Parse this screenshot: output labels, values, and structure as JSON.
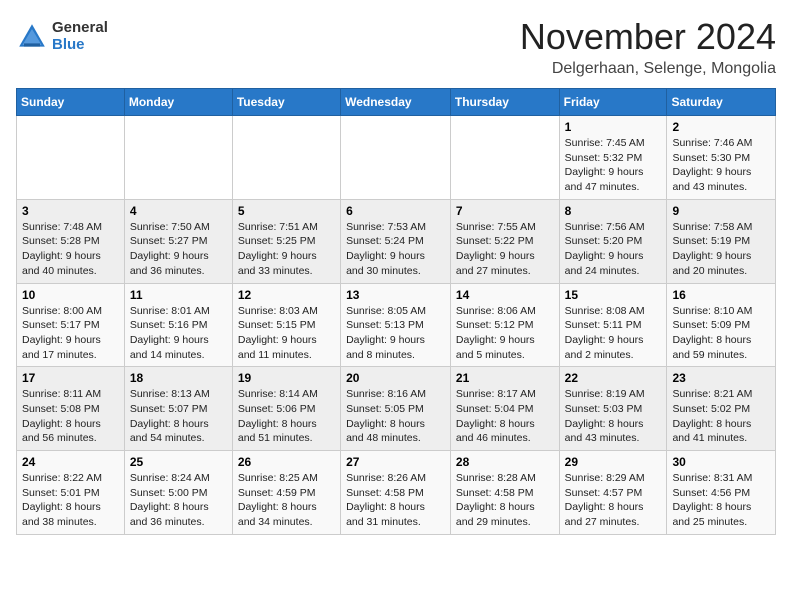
{
  "logo": {
    "general": "General",
    "blue": "Blue"
  },
  "header": {
    "month": "November 2024",
    "location": "Delgerhaan, Selenge, Mongolia"
  },
  "weekdays": [
    "Sunday",
    "Monday",
    "Tuesday",
    "Wednesday",
    "Thursday",
    "Friday",
    "Saturday"
  ],
  "weeks": [
    [
      {
        "day": "",
        "info": ""
      },
      {
        "day": "",
        "info": ""
      },
      {
        "day": "",
        "info": ""
      },
      {
        "day": "",
        "info": ""
      },
      {
        "day": "",
        "info": ""
      },
      {
        "day": "1",
        "info": "Sunrise: 7:45 AM\nSunset: 5:32 PM\nDaylight: 9 hours and 47 minutes."
      },
      {
        "day": "2",
        "info": "Sunrise: 7:46 AM\nSunset: 5:30 PM\nDaylight: 9 hours and 43 minutes."
      }
    ],
    [
      {
        "day": "3",
        "info": "Sunrise: 7:48 AM\nSunset: 5:28 PM\nDaylight: 9 hours and 40 minutes."
      },
      {
        "day": "4",
        "info": "Sunrise: 7:50 AM\nSunset: 5:27 PM\nDaylight: 9 hours and 36 minutes."
      },
      {
        "day": "5",
        "info": "Sunrise: 7:51 AM\nSunset: 5:25 PM\nDaylight: 9 hours and 33 minutes."
      },
      {
        "day": "6",
        "info": "Sunrise: 7:53 AM\nSunset: 5:24 PM\nDaylight: 9 hours and 30 minutes."
      },
      {
        "day": "7",
        "info": "Sunrise: 7:55 AM\nSunset: 5:22 PM\nDaylight: 9 hours and 27 minutes."
      },
      {
        "day": "8",
        "info": "Sunrise: 7:56 AM\nSunset: 5:20 PM\nDaylight: 9 hours and 24 minutes."
      },
      {
        "day": "9",
        "info": "Sunrise: 7:58 AM\nSunset: 5:19 PM\nDaylight: 9 hours and 20 minutes."
      }
    ],
    [
      {
        "day": "10",
        "info": "Sunrise: 8:00 AM\nSunset: 5:17 PM\nDaylight: 9 hours and 17 minutes."
      },
      {
        "day": "11",
        "info": "Sunrise: 8:01 AM\nSunset: 5:16 PM\nDaylight: 9 hours and 14 minutes."
      },
      {
        "day": "12",
        "info": "Sunrise: 8:03 AM\nSunset: 5:15 PM\nDaylight: 9 hours and 11 minutes."
      },
      {
        "day": "13",
        "info": "Sunrise: 8:05 AM\nSunset: 5:13 PM\nDaylight: 9 hours and 8 minutes."
      },
      {
        "day": "14",
        "info": "Sunrise: 8:06 AM\nSunset: 5:12 PM\nDaylight: 9 hours and 5 minutes."
      },
      {
        "day": "15",
        "info": "Sunrise: 8:08 AM\nSunset: 5:11 PM\nDaylight: 9 hours and 2 minutes."
      },
      {
        "day": "16",
        "info": "Sunrise: 8:10 AM\nSunset: 5:09 PM\nDaylight: 8 hours and 59 minutes."
      }
    ],
    [
      {
        "day": "17",
        "info": "Sunrise: 8:11 AM\nSunset: 5:08 PM\nDaylight: 8 hours and 56 minutes."
      },
      {
        "day": "18",
        "info": "Sunrise: 8:13 AM\nSunset: 5:07 PM\nDaylight: 8 hours and 54 minutes."
      },
      {
        "day": "19",
        "info": "Sunrise: 8:14 AM\nSunset: 5:06 PM\nDaylight: 8 hours and 51 minutes."
      },
      {
        "day": "20",
        "info": "Sunrise: 8:16 AM\nSunset: 5:05 PM\nDaylight: 8 hours and 48 minutes."
      },
      {
        "day": "21",
        "info": "Sunrise: 8:17 AM\nSunset: 5:04 PM\nDaylight: 8 hours and 46 minutes."
      },
      {
        "day": "22",
        "info": "Sunrise: 8:19 AM\nSunset: 5:03 PM\nDaylight: 8 hours and 43 minutes."
      },
      {
        "day": "23",
        "info": "Sunrise: 8:21 AM\nSunset: 5:02 PM\nDaylight: 8 hours and 41 minutes."
      }
    ],
    [
      {
        "day": "24",
        "info": "Sunrise: 8:22 AM\nSunset: 5:01 PM\nDaylight: 8 hours and 38 minutes."
      },
      {
        "day": "25",
        "info": "Sunrise: 8:24 AM\nSunset: 5:00 PM\nDaylight: 8 hours and 36 minutes."
      },
      {
        "day": "26",
        "info": "Sunrise: 8:25 AM\nSunset: 4:59 PM\nDaylight: 8 hours and 34 minutes."
      },
      {
        "day": "27",
        "info": "Sunrise: 8:26 AM\nSunset: 4:58 PM\nDaylight: 8 hours and 31 minutes."
      },
      {
        "day": "28",
        "info": "Sunrise: 8:28 AM\nSunset: 4:58 PM\nDaylight: 8 hours and 29 minutes."
      },
      {
        "day": "29",
        "info": "Sunrise: 8:29 AM\nSunset: 4:57 PM\nDaylight: 8 hours and 27 minutes."
      },
      {
        "day": "30",
        "info": "Sunrise: 8:31 AM\nSunset: 4:56 PM\nDaylight: 8 hours and 25 minutes."
      }
    ]
  ]
}
